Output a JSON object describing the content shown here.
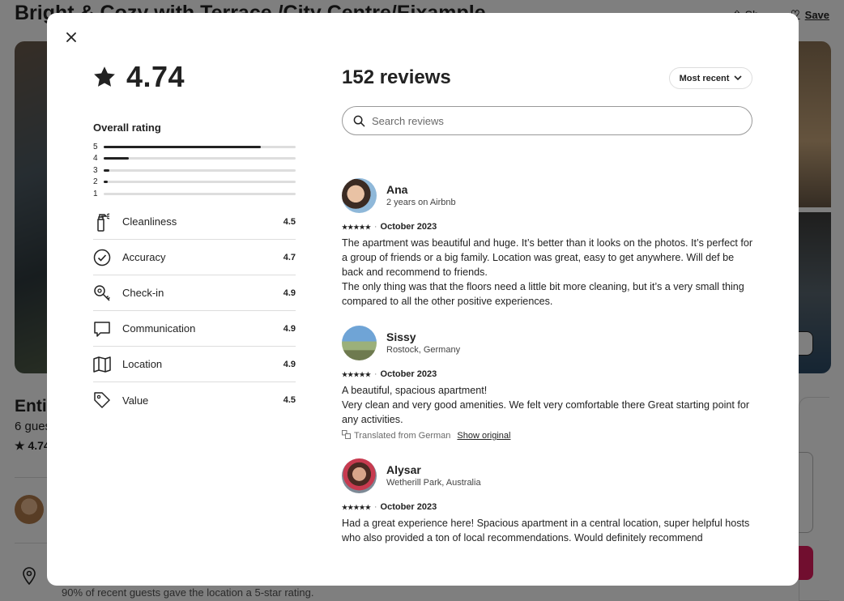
{
  "background": {
    "title": "Bright & Cozy with Terrace /City Centre/Eixample",
    "share_label": "Sh",
    "save_label": "Save",
    "listing_heading": "Entir",
    "guests_text": "6 gues",
    "rating_text": "★ 4.74",
    "location_text": "90% of recent guests gave the location a 5-star rating."
  },
  "modal": {
    "overall_rating": "4.74",
    "overall_title": "Overall rating",
    "distribution": [
      {
        "label": "5",
        "fraction": 0.82
      },
      {
        "label": "4",
        "fraction": 0.13
      },
      {
        "label": "3",
        "fraction": 0.03
      },
      {
        "label": "2",
        "fraction": 0.02
      },
      {
        "label": "1",
        "fraction": 0.0
      }
    ],
    "categories": [
      {
        "name": "Cleanliness",
        "value": "4.5",
        "icon": "spray-bottle-icon"
      },
      {
        "name": "Accuracy",
        "value": "4.7",
        "icon": "check-circle-icon"
      },
      {
        "name": "Check-in",
        "value": "4.9",
        "icon": "key-icon"
      },
      {
        "name": "Communication",
        "value": "4.9",
        "icon": "message-bubble-icon"
      },
      {
        "name": "Location",
        "value": "4.9",
        "icon": "map-icon"
      },
      {
        "name": "Value",
        "value": "4.5",
        "icon": "tag-icon"
      }
    ],
    "reviews_title": "152 reviews",
    "sort_label": "Most recent",
    "search_placeholder": "Search reviews",
    "reviews": [
      {
        "name": "Ana",
        "subtitle": "2 years on Airbnb",
        "stars": "★★★★★",
        "date": "October 2023",
        "paragraphs": [
          "The apartment was beautiful and huge. It’s better than it looks on the photos. It’s perfect for a group of friends or a big family. Location was great, easy to get anywhere. Will def be back and recommend to friends.",
          "The only thing was that the floors need a little bit more cleaning, but it’s a very small thing compared to all the other positive experiences."
        ]
      },
      {
        "name": "Sissy",
        "subtitle": "Rostock, Germany",
        "stars": "★★★★★",
        "date": "October 2023",
        "paragraphs": [
          "A beautiful, spacious apartment!",
          "Very clean and very good amenities. We felt very comfortable there Great starting point for any activities."
        ],
        "translated_note": "Translated from German",
        "show_original": "Show original"
      },
      {
        "name": "Alysar",
        "subtitle": "Wetherill Park, Australia",
        "stars": "★★★★★",
        "date": "October 2023",
        "paragraphs": [
          "Had a great experience here! Spacious apartment in a central location, super helpful hosts who also provided a ton of local recommendations. Would definitely recommend"
        ]
      }
    ]
  }
}
